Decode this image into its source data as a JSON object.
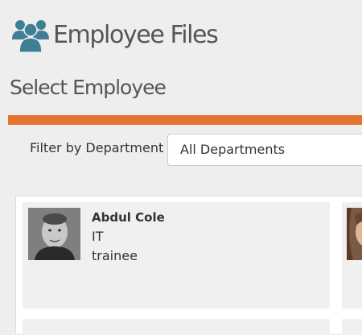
{
  "header": {
    "icon": "users-group-icon",
    "title": "Employee Files"
  },
  "section": {
    "title": "Select Employee"
  },
  "filter": {
    "label": "Filter by Department",
    "selected": "All Departments"
  },
  "employees": [
    {
      "name": "Abdul Cole",
      "department": "IT",
      "role": "trainee"
    }
  ],
  "colors": {
    "accent": "#e67330",
    "icon": "#3f7f96",
    "background": "#eeeeee",
    "card": "#eff0ef"
  }
}
